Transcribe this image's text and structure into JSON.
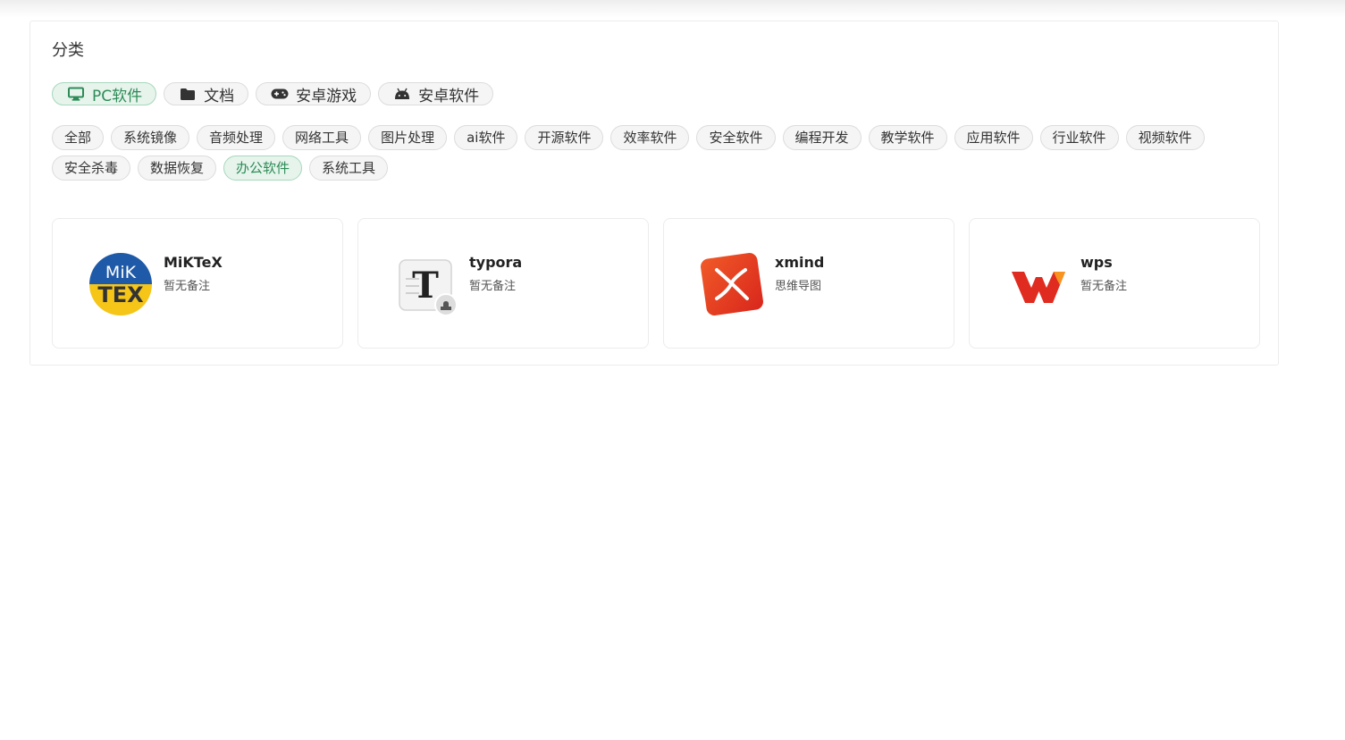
{
  "category": {
    "title": "分类",
    "main_tabs": [
      {
        "label": "PC软件",
        "icon": "monitor-icon",
        "active": true
      },
      {
        "label": "文档",
        "icon": "folder-icon",
        "active": false
      },
      {
        "label": "安卓游戏",
        "icon": "gamepad-icon",
        "active": false
      },
      {
        "label": "安卓软件",
        "icon": "android-icon",
        "active": false
      }
    ],
    "sub_tabs": [
      {
        "label": "全部",
        "active": false
      },
      {
        "label": "系统镜像",
        "active": false
      },
      {
        "label": "音频处理",
        "active": false
      },
      {
        "label": "网络工具",
        "active": false
      },
      {
        "label": "图片处理",
        "active": false
      },
      {
        "label": "ai软件",
        "active": false
      },
      {
        "label": "开源软件",
        "active": false
      },
      {
        "label": "效率软件",
        "active": false
      },
      {
        "label": "安全软件",
        "active": false
      },
      {
        "label": "编程开发",
        "active": false
      },
      {
        "label": "教学软件",
        "active": false
      },
      {
        "label": "应用软件",
        "active": false
      },
      {
        "label": "行业软件",
        "active": false
      },
      {
        "label": "视频软件",
        "active": false
      },
      {
        "label": "安全杀毒",
        "active": false
      },
      {
        "label": "数据恢复",
        "active": false
      },
      {
        "label": "办公软件",
        "active": true
      },
      {
        "label": "系统工具",
        "active": false
      }
    ]
  },
  "software": [
    {
      "name": "MiKTeX",
      "desc": "暂无备注",
      "icon": "miktex-logo",
      "logo_text_top": "MiK",
      "logo_text_bottom": "TEX"
    },
    {
      "name": "typora",
      "desc": "暂无备注",
      "icon": "typora-logo",
      "logo_text": "T"
    },
    {
      "name": "xmind",
      "desc": "思维导图",
      "icon": "xmind-logo"
    },
    {
      "name": "wps",
      "desc": "暂无备注",
      "icon": "wps-logo"
    }
  ],
  "colors": {
    "accent": "#2e8b57",
    "accent_bg": "#e6f4ec",
    "miktex_blue": "#1f5aa8",
    "miktex_yellow": "#f5c518",
    "xmind_red": "#e8341c",
    "wps_red": "#e02b20"
  }
}
